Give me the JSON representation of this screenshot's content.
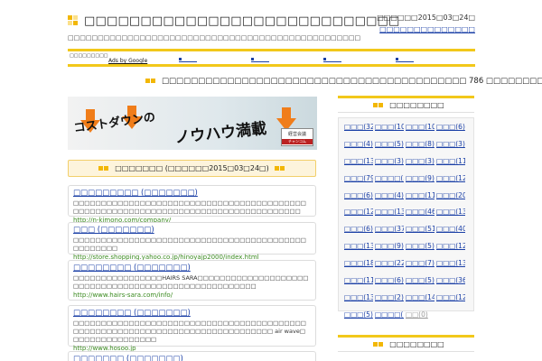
{
  "header": {
    "title": "□□□□□□□□□□□□□□□□□□□□□□□□□□□□",
    "subtitle": "□□□□□□□□□□□□□□□□□□□□□□□□□□□□□□□□□□□□□□□□□□□□□□□□□",
    "date": "□□□□□□2015□03□24□",
    "link": "□□□□□□□□□□□□□□"
  },
  "adbar": {
    "label": "□□□□□□□□□",
    "google": "Ads by Google"
  },
  "count_line": "□□□□□□□□□□□□□□□□□□□□□□□□□□□□□□□□□□□□□□□□□□ 786 □□□□□□□□",
  "banner": {
    "text1": "コストダウンの",
    "text2": "ノウハウ満載",
    "stamp_top": "経営会議",
    "stamp_bottom": "チャンコム"
  },
  "main_section_header": "□□□□□□□ (□□□□□□2015□03□24□)",
  "entries": [
    {
      "title": "□□□□□□□□□ (□□□□□□□)",
      "desc": "□□□□□□□□□□□□□□□□□□□□□□□□□□□□□□□□□□□□□□□□□□□□□□□□□□□□□□□□□□□□□□□□□□□□□□□□□□□□□□□□□□□",
      "url": "http://n-kimono.com/company/"
    },
    {
      "title": "□□□ (□□□□□□□)",
      "desc": "□□□□□□□□□□□□□□□□□□□□□□□□□□□□□□□□□□□□□□□□□□□□□□□□□□",
      "url": "http://store.shopping.yahoo.co.jp/hinoyajp2000/index.html"
    },
    {
      "title": "□□□□□□□□ (□□□□□□□)",
      "desc": "□□□□□□□□□□□□□□□□HAIRS SARA□□□□□□□□□□□□□□□□□□□□□□□□□□□□□□□□□□□□□□□□□□□□□□□□□□□□□",
      "url": "http://www.hairs-sara.com/info/"
    },
    {
      "title": "□□□□□□□□ (□□□□□□□)",
      "desc": "□□□□□□□□□□□□□□□□□□□□□□□□□□□□□□□□□□□□□□□□□□□□□□□□□□□□□□□□□□□□□□□□□□□□□□□□□□□□□□ air wave□□□□□□□□□□□□□□□□",
      "url": "http://www.hosoo.jp"
    },
    {
      "title": "□□□□□□□ (□□□□□□□)",
      "desc": "",
      "url": ""
    }
  ],
  "sidebar": {
    "categories_header": "□□□□□□□□",
    "categories": [
      "□□□(32)",
      "□□□(10)",
      "□□□(10)",
      "□□□(6)",
      "□□□(4)",
      "□□□(5)",
      "□□□(8)",
      "□□□(3)",
      "□□□(13)",
      "□□□(3)",
      "□□□(3)",
      "□□□(11)",
      "□□□(79)",
      "□□□□(33)",
      "□□□(9)",
      "□□□(12)",
      "□□□(6)",
      "□□□(4)",
      "□□□(11)",
      "□□□(20)",
      "□□□(12)",
      "□□□(13)",
      "□□□(46)",
      "□□□(13)",
      "□□□(6)",
      "□□□(37)",
      "□□□(51)",
      "□□□(40)",
      "□□□(13)",
      "□□□(9)",
      "□□□(5)",
      "□□□(12)",
      "□□□(18)",
      "□□□(22)",
      "□□□(7)",
      "□□□(13)",
      "□□□(11)",
      "□□□(6)",
      "□□□(5)",
      "□□□(36)",
      "□□□(13)",
      "□□□(2)",
      "□□□(14)",
      "□□□(12)",
      "□□□(5)",
      "□□□□(14)",
      "□□(0)"
    ],
    "second_header": "□□□□□□□□"
  },
  "colors": {
    "accent": "#f2b705",
    "link": "#1a3fa6",
    "url": "#3a8a1f"
  }
}
